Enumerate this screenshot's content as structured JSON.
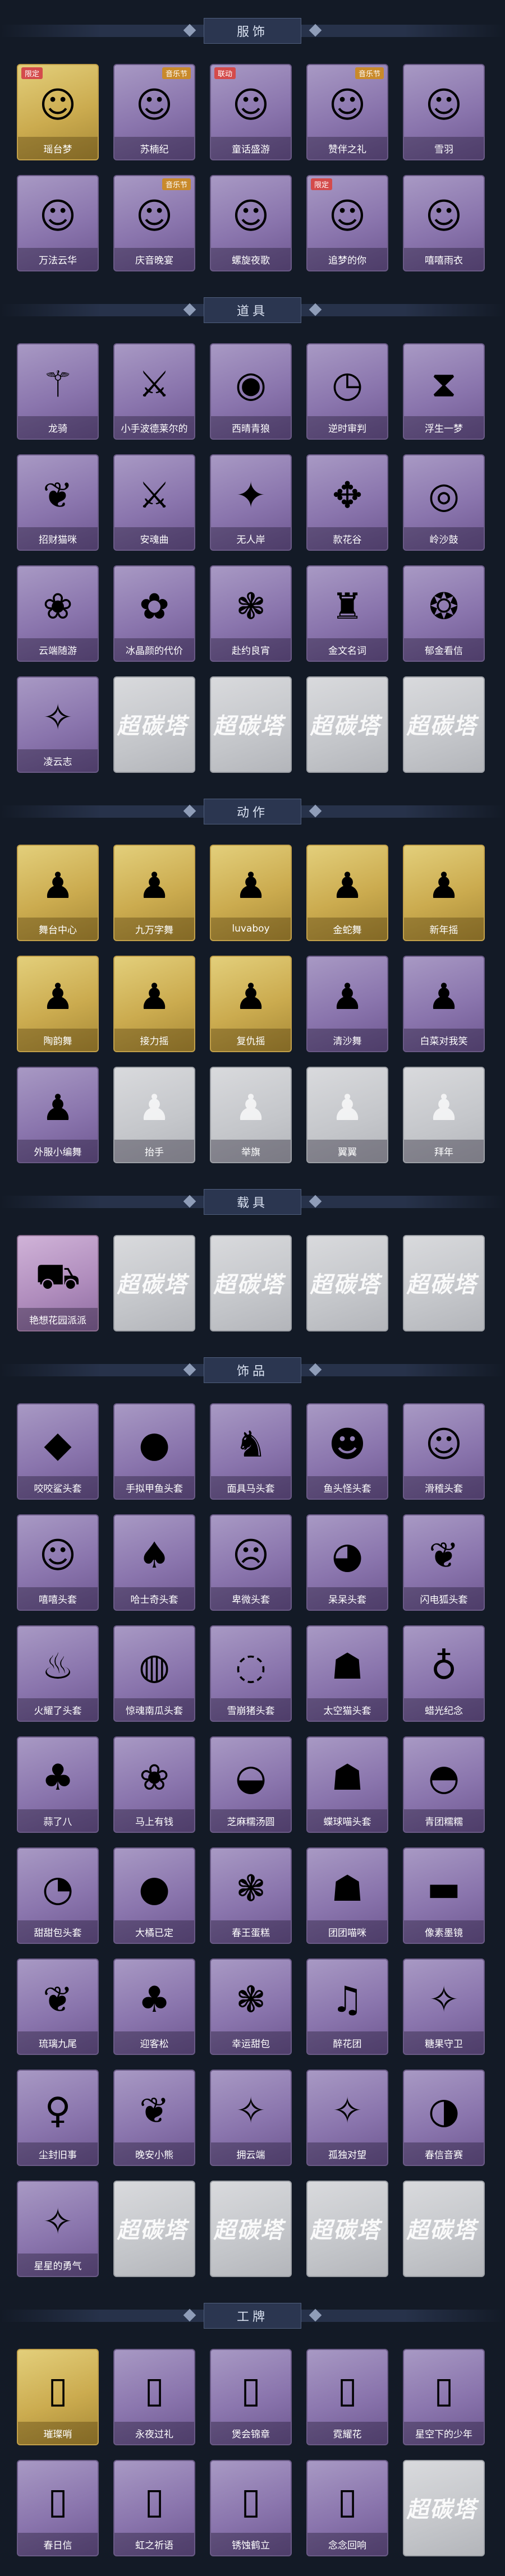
{
  "sections": {
    "clothing": {
      "title": "服饰",
      "items": [
        {
          "label": "瑶台梦",
          "icon": "portrait-icon",
          "tier": "gold",
          "badge": "限定"
        },
        {
          "label": "苏楠纪",
          "icon": "portrait-icon",
          "tier": "purple",
          "badge": "音乐节"
        },
        {
          "label": "童话盛游",
          "icon": "portrait-icon",
          "tier": "purple",
          "badge": "联动"
        },
        {
          "label": "赞伴之礼",
          "icon": "portrait-icon",
          "tier": "purple",
          "badge": "音乐节"
        },
        {
          "label": "雪羽",
          "icon": "portrait-icon",
          "tier": "purple"
        },
        {
          "label": "万法云华",
          "icon": "portrait-icon",
          "tier": "purple"
        },
        {
          "label": "庆音晚宴",
          "icon": "portrait-icon",
          "tier": "purple",
          "badge": "音乐节"
        },
        {
          "label": "螺旋夜歌",
          "icon": "portrait-icon",
          "tier": "purple"
        },
        {
          "label": "追梦的你",
          "icon": "portrait-icon",
          "tier": "purple",
          "badge": "限定"
        },
        {
          "label": "嘻嘻雨衣",
          "icon": "portrait-icon",
          "tier": "purple"
        }
      ]
    },
    "props": {
      "title": "道具",
      "items": [
        {
          "label": "龙骑",
          "icon": "staff-icon",
          "tier": "purple"
        },
        {
          "label": "小手波德莱尔的",
          "icon": "sword-icon",
          "tier": "purple"
        },
        {
          "label": "西晴青狼",
          "icon": "disc-icon",
          "tier": "purple"
        },
        {
          "label": "逆时审判",
          "icon": "clock-icon",
          "tier": "purple"
        },
        {
          "label": "浮生一梦",
          "icon": "hourglass-icon",
          "tier": "purple"
        },
        {
          "label": "招财猫咪",
          "icon": "fox-icon",
          "tier": "purple"
        },
        {
          "label": "安魂曲",
          "icon": "blade-icon",
          "tier": "purple"
        },
        {
          "label": "无人岸",
          "icon": "orb-icon",
          "tier": "purple"
        },
        {
          "label": "款花谷",
          "icon": "compass-icon",
          "tier": "purple"
        },
        {
          "label": "岭沙鼓",
          "icon": "drum-icon",
          "tier": "purple"
        },
        {
          "label": "云端随游",
          "icon": "bird-icon",
          "tier": "purple"
        },
        {
          "label": "冰晶颜的代价",
          "icon": "flower-icon",
          "tier": "purple"
        },
        {
          "label": "赴约良宵",
          "icon": "cake-icon",
          "tier": "purple"
        },
        {
          "label": "金文名词",
          "icon": "bottle-icon",
          "tier": "purple"
        },
        {
          "label": "郁金看信",
          "icon": "fan-icon",
          "tier": "purple"
        },
        {
          "label": "凌云志",
          "icon": "kite-icon",
          "tier": "purple"
        },
        {
          "label": "超碳塔",
          "tier": "locked"
        },
        {
          "label": "超碳塔",
          "tier": "locked"
        },
        {
          "label": "超碳塔",
          "tier": "locked"
        },
        {
          "label": "超碳塔",
          "tier": "locked"
        }
      ]
    },
    "actions": {
      "title": "动作",
      "items": [
        {
          "label": "舞台中心",
          "icon": "pose-icon",
          "tier": "gold"
        },
        {
          "label": "九万字舞",
          "icon": "pose-icon",
          "tier": "gold"
        },
        {
          "label": "luvaboy",
          "icon": "pose-icon",
          "tier": "gold"
        },
        {
          "label": "金蛇舞",
          "icon": "pose-icon",
          "tier": "gold"
        },
        {
          "label": "新年摇",
          "icon": "pose-icon",
          "tier": "gold"
        },
        {
          "label": "陶韵舞",
          "icon": "pose-icon",
          "tier": "gold"
        },
        {
          "label": "接力摇",
          "icon": "pose-icon",
          "tier": "gold"
        },
        {
          "label": "复仇摇",
          "icon": "pose-icon",
          "tier": "gold"
        },
        {
          "label": "清沙舞",
          "icon": "pose-icon",
          "tier": "purple"
        },
        {
          "label": "白菜对我笑",
          "icon": "pose-icon",
          "tier": "purple"
        },
        {
          "label": "外服小编舞",
          "icon": "pose-icon",
          "tier": "purple"
        },
        {
          "label": "抬手",
          "icon": "pose-icon",
          "tier": "locked-pose"
        },
        {
          "label": "举旗",
          "icon": "pose-icon",
          "tier": "locked-pose"
        },
        {
          "label": "翼翼",
          "icon": "pose-icon",
          "tier": "locked-pose"
        },
        {
          "label": "拜年",
          "icon": "pose-icon",
          "tier": "locked-pose"
        }
      ]
    },
    "vehicles": {
      "title": "载具",
      "items": [
        {
          "label": "艳想花园派派",
          "icon": "cart-icon",
          "tier": "pink"
        },
        {
          "label": "超碳塔",
          "tier": "locked"
        },
        {
          "label": "超碳塔",
          "tier": "locked"
        },
        {
          "label": "超碳塔",
          "tier": "locked"
        },
        {
          "label": "超碳塔",
          "tier": "locked"
        }
      ]
    },
    "accessories": {
      "title": "饰品",
      "items": [
        {
          "label": "咬咬鲨头套",
          "icon": "shark-icon",
          "tier": "purple"
        },
        {
          "label": "手拟甲鱼头套",
          "icon": "seal-icon",
          "tier": "purple"
        },
        {
          "label": "面具马头套",
          "icon": "horse-icon",
          "tier": "purple"
        },
        {
          "label": "鱼头怪头套",
          "icon": "frog-icon",
          "tier": "purple"
        },
        {
          "label": "滑稽头套",
          "icon": "smile-icon",
          "tier": "purple"
        },
        {
          "label": "嘻嘻头套",
          "icon": "grin-icon",
          "tier": "purple"
        },
        {
          "label": "哈士奇头套",
          "icon": "dog-icon",
          "tier": "purple"
        },
        {
          "label": "卑微头套",
          "icon": "sad-icon",
          "tier": "purple"
        },
        {
          "label": "呆呆头套",
          "icon": "stare-icon",
          "tier": "purple"
        },
        {
          "label": "闪电狐头套",
          "icon": "fox-icon",
          "tier": "purple"
        },
        {
          "label": "火耀了头套",
          "icon": "flame-icon",
          "tier": "purple"
        },
        {
          "label": "惊魂南瓜头套",
          "icon": "pumpkin-icon",
          "tier": "purple"
        },
        {
          "label": "雪崩猪头套",
          "icon": "pig-icon",
          "tier": "purple"
        },
        {
          "label": "太空猫头套",
          "icon": "cat-icon",
          "tier": "purple"
        },
        {
          "label": "蜡光纪念",
          "icon": "candle-icon",
          "tier": "purple"
        },
        {
          "label": "蒜了八",
          "icon": "garlic-icon",
          "tier": "purple"
        },
        {
          "label": "马上有钱",
          "icon": "bird-icon",
          "tier": "purple"
        },
        {
          "label": "芝麻糯汤圆",
          "icon": "dumpling-icon",
          "tier": "purple"
        },
        {
          "label": "蝶球喵头套",
          "icon": "cat-icon",
          "tier": "purple"
        },
        {
          "label": "青团糯糯",
          "icon": "blob-icon",
          "tier": "purple"
        },
        {
          "label": "甜甜包头套",
          "icon": "bun-icon",
          "tier": "purple"
        },
        {
          "label": "大橘已定",
          "icon": "orange-icon",
          "tier": "purple"
        },
        {
          "label": "春王蛋糕",
          "icon": "cake-icon",
          "tier": "purple"
        },
        {
          "label": "团团喵咪",
          "icon": "cat-icon",
          "tier": "purple"
        },
        {
          "label": "像素墨镜",
          "icon": "sunglasses-icon",
          "tier": "purple"
        },
        {
          "label": "琉璃九尾",
          "icon": "fox-icon",
          "tier": "purple"
        },
        {
          "label": "迎客松",
          "icon": "tree-icon",
          "tier": "purple"
        },
        {
          "label": "幸运甜包",
          "icon": "cake-icon",
          "tier": "purple"
        },
        {
          "label": "醉花团",
          "icon": "bell-icon",
          "tier": "purple"
        },
        {
          "label": "糖果守卫",
          "icon": "charm-icon",
          "tier": "purple"
        },
        {
          "label": "尘封旧事",
          "icon": "doll-icon",
          "tier": "purple"
        },
        {
          "label": "晚安小熊",
          "icon": "bear-icon",
          "tier": "purple"
        },
        {
          "label": "拥云端",
          "icon": "charm-icon",
          "tier": "purple"
        },
        {
          "label": "孤独对望",
          "icon": "charm-icon",
          "tier": "purple"
        },
        {
          "label": "春信音赛",
          "icon": "bulb-icon",
          "tier": "purple"
        },
        {
          "label": "星星的勇气",
          "icon": "charm-icon",
          "tier": "purple"
        },
        {
          "label": "超碳塔",
          "tier": "locked"
        },
        {
          "label": "超碳塔",
          "tier": "locked"
        },
        {
          "label": "超碳塔",
          "tier": "locked"
        },
        {
          "label": "超碳塔",
          "tier": "locked"
        }
      ]
    },
    "nameplates": {
      "title": "工牌",
      "items": [
        {
          "label": "璀璨哨",
          "icon": "card-icon",
          "tier": "gold"
        },
        {
          "label": "永夜过礼",
          "icon": "card-icon",
          "tier": "purple"
        },
        {
          "label": "煲会锦章",
          "icon": "card-icon",
          "tier": "purple"
        },
        {
          "label": "霓耀花",
          "icon": "card-icon",
          "tier": "purple"
        },
        {
          "label": "星空下的少年",
          "icon": "card-icon",
          "tier": "purple"
        },
        {
          "label": "春日信",
          "icon": "card-icon",
          "tier": "purple"
        },
        {
          "label": "虹之祈语",
          "icon": "card-icon",
          "tier": "purple"
        },
        {
          "label": "锈蚀鹤立",
          "icon": "card-icon",
          "tier": "purple"
        },
        {
          "label": "念念回响",
          "icon": "card-icon",
          "tier": "purple"
        },
        {
          "label": "超碳塔",
          "tier": "locked"
        }
      ]
    }
  }
}
